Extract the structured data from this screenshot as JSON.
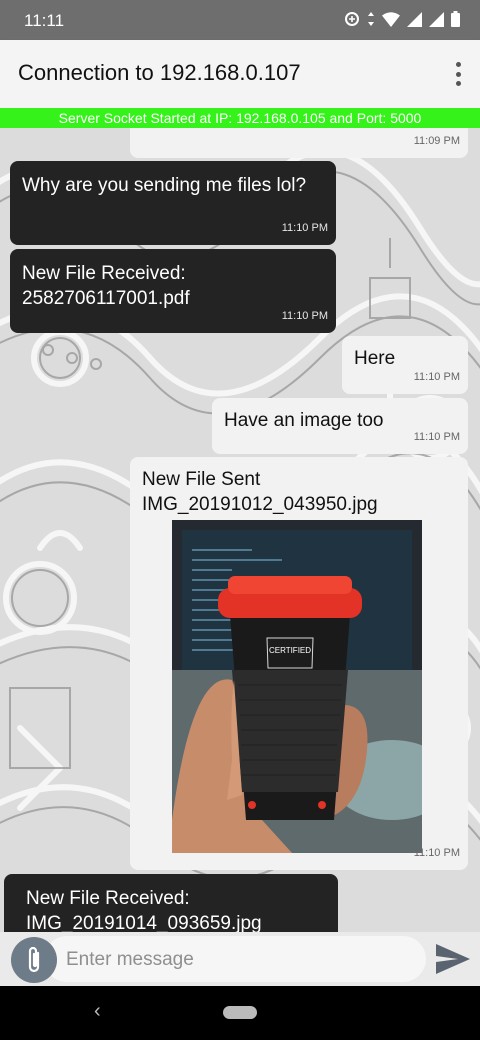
{
  "status_bar": {
    "time": "11:11"
  },
  "app_bar": {
    "title": "Connection to 192.168.0.107"
  },
  "banner": {
    "text": "Server Socket Started at IP: 192.168.0.105 and Port: 5000"
  },
  "messages": [
    {
      "type": "sent",
      "text": "",
      "time": "11:09 PM"
    },
    {
      "type": "received",
      "text": "Why are you sending me files lol?",
      "time": "11:10 PM"
    },
    {
      "type": "received",
      "text": "New File Received: 2582706117001.pdf",
      "time": "11:10 PM"
    },
    {
      "type": "sent",
      "text": "Here",
      "time": "11:10 PM"
    },
    {
      "type": "sent",
      "text": "Have an image too",
      "time": "11:10 PM"
    },
    {
      "type": "sent",
      "text": "New File Sent IMG_20191012_043950.jpg",
      "time": "11:10 PM",
      "photo_label": "CERTIFIED"
    },
    {
      "type": "received",
      "text": "New File Received: IMG_20191014_093659.jpg",
      "time": ""
    }
  ],
  "input": {
    "placeholder": "Enter message"
  },
  "colors": {
    "banner": "#35f21a",
    "received_bubble": "#232323",
    "sent_bubble": "#f2f2f2",
    "attach_button": "#6e7b88"
  },
  "icons": [
    "wifi-icon",
    "signal-icon",
    "battery-icon",
    "more-vert-icon",
    "attach-icon",
    "send-icon",
    "back-icon",
    "home-icon"
  ]
}
